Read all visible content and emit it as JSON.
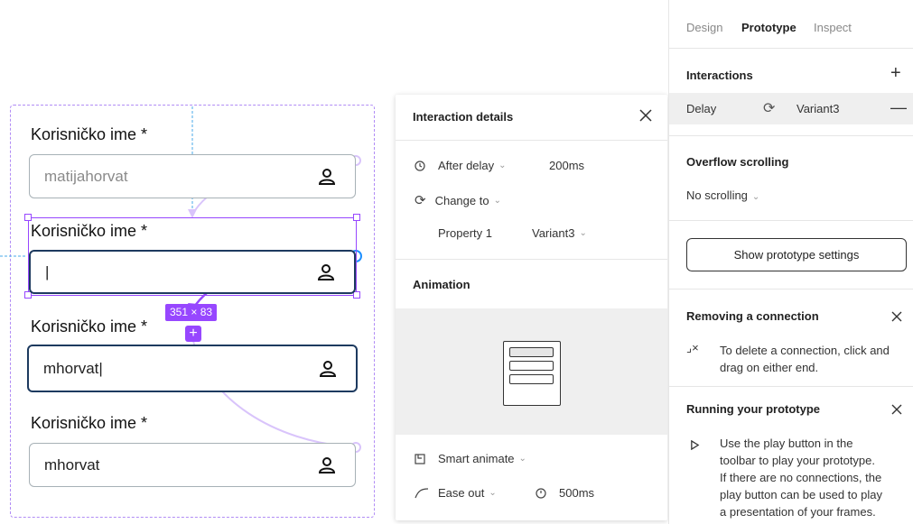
{
  "canvas": {
    "dimension_badge": "351 × 83",
    "fields": [
      {
        "label": "Korisničko ime *",
        "value": "matijahorvat",
        "state": "placeholder"
      },
      {
        "label": "Korisničko ime *",
        "value": "|",
        "state": "focused-selected"
      },
      {
        "label": "Korisničko ime *",
        "value": "mhorvat|",
        "state": "active"
      },
      {
        "label": "Korisničko ime *",
        "value": "mhorvat",
        "state": "default"
      }
    ],
    "colors": {
      "selection": "#9747ff",
      "frame_dashed": "#b18cf5",
      "active_border": "#1d3a5f"
    }
  },
  "details": {
    "title": "Interaction details",
    "trigger": "After delay",
    "delay": "200ms",
    "action": "Change to",
    "property_label": "Property 1",
    "property_value": "Variant3",
    "animation_title": "Animation",
    "animation_type": "Smart animate",
    "easing": "Ease out",
    "duration": "500ms"
  },
  "sidebar": {
    "tabs": [
      "Design",
      "Prototype",
      "Inspect"
    ],
    "active_tab": "Prototype",
    "interactions_title": "Interactions",
    "interaction": {
      "trigger": "Delay",
      "target": "Variant3"
    },
    "overflow_title": "Overflow scrolling",
    "overflow_value": "No scrolling",
    "settings_button": "Show prototype settings",
    "tip1": {
      "title": "Removing a connection",
      "text": "To delete a connection, click and drag on either end."
    },
    "tip2": {
      "title": "Running your prototype",
      "lines": [
        "Use the play button in the",
        "toolbar to play your prototype.",
        "If there are no connections, the",
        "play button can be used to play",
        "a presentation of your frames."
      ]
    }
  }
}
